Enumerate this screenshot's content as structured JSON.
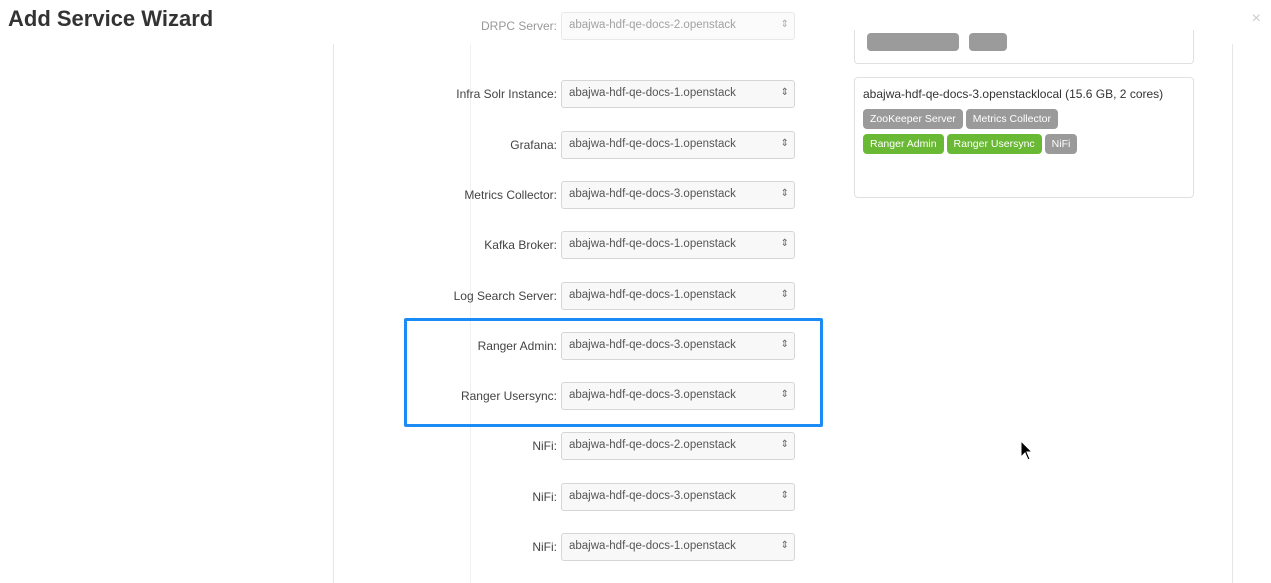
{
  "header": {
    "title": "Add Service Wizard",
    "close": "×"
  },
  "rows": [
    {
      "label": "DRPC Server:",
      "value": "abajwa-hdf-qe-docs-2.openstack",
      "clipped": true
    },
    {
      "label": "Infra Solr Instance:",
      "value": "abajwa-hdf-qe-docs-1.openstack"
    },
    {
      "label": "Grafana:",
      "value": "abajwa-hdf-qe-docs-1.openstack"
    },
    {
      "label": "Metrics Collector:",
      "value": "abajwa-hdf-qe-docs-3.openstack"
    },
    {
      "label": "Kafka Broker:",
      "value": "abajwa-hdf-qe-docs-1.openstack"
    },
    {
      "label": "Log Search Server:",
      "value": "abajwa-hdf-qe-docs-1.openstack"
    },
    {
      "label": "Ranger Admin:",
      "value": "abajwa-hdf-qe-docs-3.openstack"
    },
    {
      "label": "Ranger Usersync:",
      "value": "abajwa-hdf-qe-docs-3.openstack"
    },
    {
      "label": "NiFi:",
      "value": "abajwa-hdf-qe-docs-2.openstack"
    },
    {
      "label": "NiFi:",
      "value": "abajwa-hdf-qe-docs-3.openstack"
    },
    {
      "label": "NiFi:",
      "value": "abajwa-hdf-qe-docs-1.openstack"
    }
  ],
  "caret": "⇕",
  "host": {
    "title": "abajwa-hdf-qe-docs-3.openstacklocal (15.6 GB, 2 cores)",
    "badges": [
      {
        "label": "ZooKeeper Server",
        "color": "#9a9a9a"
      },
      {
        "label": "Metrics Collector",
        "color": "#9a9a9a"
      },
      {
        "label": "Ranger Admin",
        "color": "#6ab934"
      },
      {
        "label": "Ranger Usersync",
        "color": "#6ab934"
      },
      {
        "label": "NiFi",
        "color": "#9a9a9a"
      }
    ]
  },
  "colors": {
    "highlight": "#1b8cf5",
    "green_badge": "#6ab934",
    "grey_badge": "#9a9a9a"
  }
}
